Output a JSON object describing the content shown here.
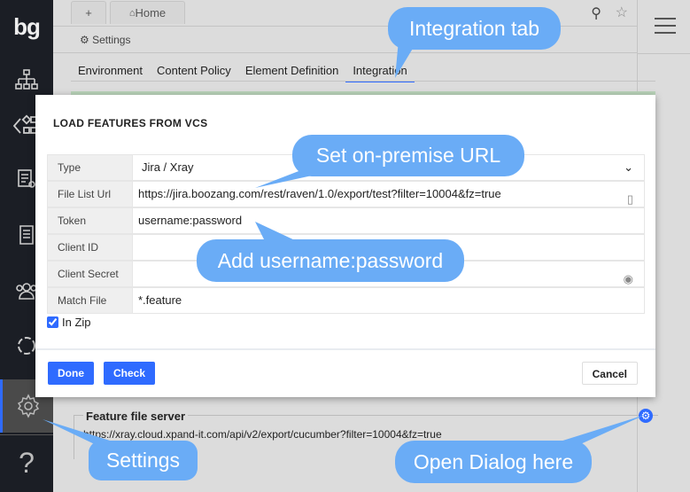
{
  "sidebar": {
    "logo": "bg",
    "items": [
      "sitemap-icon",
      "elements-icon",
      "test-icon",
      "document-icon",
      "users-icon",
      "refresh-icon",
      "gear-icon",
      "help-icon"
    ]
  },
  "topbar": {
    "add_tab": "+",
    "home_tab": "Home"
  },
  "header": {
    "settings_label": "Settings"
  },
  "tabs": [
    "Environment",
    "Content Policy",
    "Element Definition",
    "Integration"
  ],
  "dialog": {
    "title": "LOAD FEATURES FROM VCS",
    "fields": [
      {
        "label": "Type",
        "value": "Jira / Xray"
      },
      {
        "label": "File List Url",
        "value": "https://jira.boozang.com/rest/raven/1.0/export/test?filter=10004&fz=true"
      },
      {
        "label": "Token",
        "value": "username:password"
      },
      {
        "label": "Client ID",
        "value": ""
      },
      {
        "label": "Client Secret",
        "value": ""
      },
      {
        "label": "Match File",
        "value": "*.feature"
      }
    ],
    "in_zip_label": "In Zip",
    "in_zip": true,
    "done": "Done",
    "check": "Check",
    "cancel": "Cancel"
  },
  "feature_server": {
    "title": "Feature file server",
    "url": "https://xray.cloud.xpand-it.com/api/v2/export/cucumber?filter=10004&fz=true"
  },
  "callouts": {
    "integration": "Integration tab",
    "url": "Set on-premise URL",
    "token": "Add username:password",
    "settings": "Settings",
    "open": "Open Dialog here"
  },
  "colors": {
    "accent": "#2f6bff",
    "callout": "#6aacf6",
    "sidebar": "#1b1e25"
  }
}
